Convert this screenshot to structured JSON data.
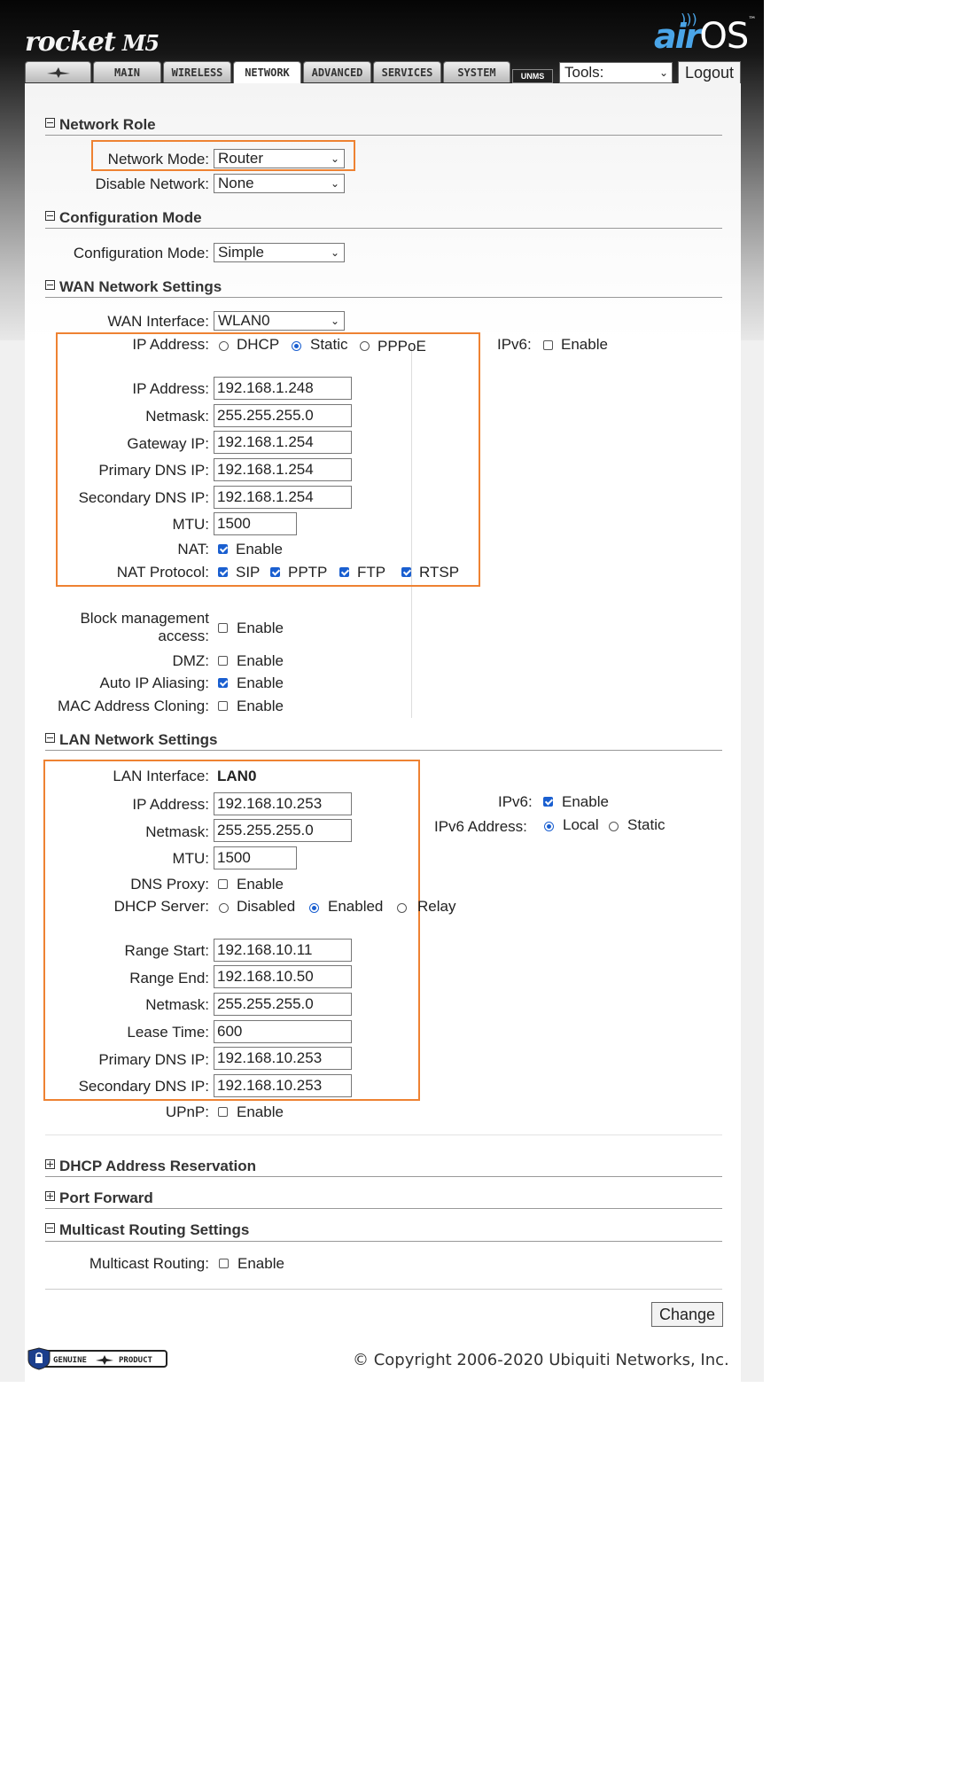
{
  "header": {
    "logo": "rocket",
    "logo_model": "M5",
    "brand_air": "air",
    "brand_os": "OS",
    "brand_tm": "™"
  },
  "tabs": [
    {
      "label": ""
    },
    {
      "label": "MAIN"
    },
    {
      "label": "WIRELESS"
    },
    {
      "label": "NETWORK",
      "active": true
    },
    {
      "label": "ADVANCED"
    },
    {
      "label": "SERVICES"
    },
    {
      "label": "SYSTEM"
    }
  ],
  "unms": "UNMS",
  "tools": {
    "value": "Tools:"
  },
  "logout": "Logout",
  "network_role": {
    "title": "Network Role",
    "network_mode_label": "Network Mode:",
    "network_mode": "Router",
    "disable_network_label": "Disable Network:",
    "disable_network": "None"
  },
  "config_mode": {
    "title": "Configuration Mode",
    "label": "Configuration Mode:",
    "value": "Simple"
  },
  "wan": {
    "title": "WAN Network Settings",
    "interface_label": "WAN Interface:",
    "interface": "WLAN0",
    "ip_mode_label": "IP Address:",
    "dhcp": "DHCP",
    "static": "Static",
    "pppoe": "PPPoE",
    "ipv6_label": "IPv6:",
    "ipv6_enable": "Enable",
    "ip_label": "IP Address:",
    "ip": "192.168.1.248",
    "netmask_label": "Netmask:",
    "netmask": "255.255.255.0",
    "gateway_label": "Gateway IP:",
    "gateway": "192.168.1.254",
    "dns1_label": "Primary DNS IP:",
    "dns1": "192.168.1.254",
    "dns2_label": "Secondary DNS IP:",
    "dns2": "192.168.1.254",
    "mtu_label": "MTU:",
    "mtu": "1500",
    "nat_label": "NAT:",
    "nat_enable": "Enable",
    "nat_proto_label": "NAT Protocol:",
    "sip": "SIP",
    "pptp": "PPTP",
    "ftp": "FTP",
    "rtsp": "RTSP",
    "block_label_1": "Block management",
    "block_label_2": "access:",
    "block_enable": "Enable",
    "dmz_label": "DMZ:",
    "dmz_enable": "Enable",
    "alias_label": "Auto IP Aliasing:",
    "alias_enable": "Enable",
    "mac_label": "MAC Address Cloning:",
    "mac_enable": "Enable"
  },
  "lan": {
    "title": "LAN Network Settings",
    "interface_label": "LAN Interface:",
    "interface": "LAN0",
    "ip_label": "IP Address:",
    "ip": "192.168.10.253",
    "netmask_label": "Netmask:",
    "netmask": "255.255.255.0",
    "mtu_label": "MTU:",
    "mtu": "1500",
    "dnsproxy_label": "DNS Proxy:",
    "dnsproxy_enable": "Enable",
    "dhcp_label": "DHCP Server:",
    "disabled": "Disabled",
    "enabled": "Enabled",
    "relay": "Relay",
    "ipv6_label": "IPv6:",
    "ipv6_enable": "Enable",
    "ipv6_addr_label": "IPv6 Address:",
    "local": "Local",
    "static": "Static",
    "range_start_label": "Range Start:",
    "range_start": "192.168.10.11",
    "range_end_label": "Range End:",
    "range_end": "192.168.10.50",
    "dhcp_netmask_label": "Netmask:",
    "dhcp_netmask": "255.255.255.0",
    "lease_label": "Lease Time:",
    "lease": "600",
    "dns1_label": "Primary DNS IP:",
    "dns1": "192.168.10.253",
    "dns2_label": "Secondary DNS IP:",
    "dns2": "192.168.10.253",
    "upnp_label": "UPnP:",
    "upnp_enable": "Enable"
  },
  "dhcp_reservation": {
    "title": "DHCP Address Reservation"
  },
  "port_forward": {
    "title": "Port Forward"
  },
  "multicast": {
    "title": "Multicast Routing Settings",
    "label": "Multicast Routing:",
    "enable": "Enable"
  },
  "change": "Change",
  "badge": {
    "left": "GENUINE",
    "right": "PRODUCT"
  },
  "copyright": "© Copyright 2006-2020 Ubiquiti Networks, Inc.",
  "colors": {
    "highlight": "#ee8232",
    "check": "#1a5fd0",
    "brand_blue": "#4aa5e8"
  }
}
